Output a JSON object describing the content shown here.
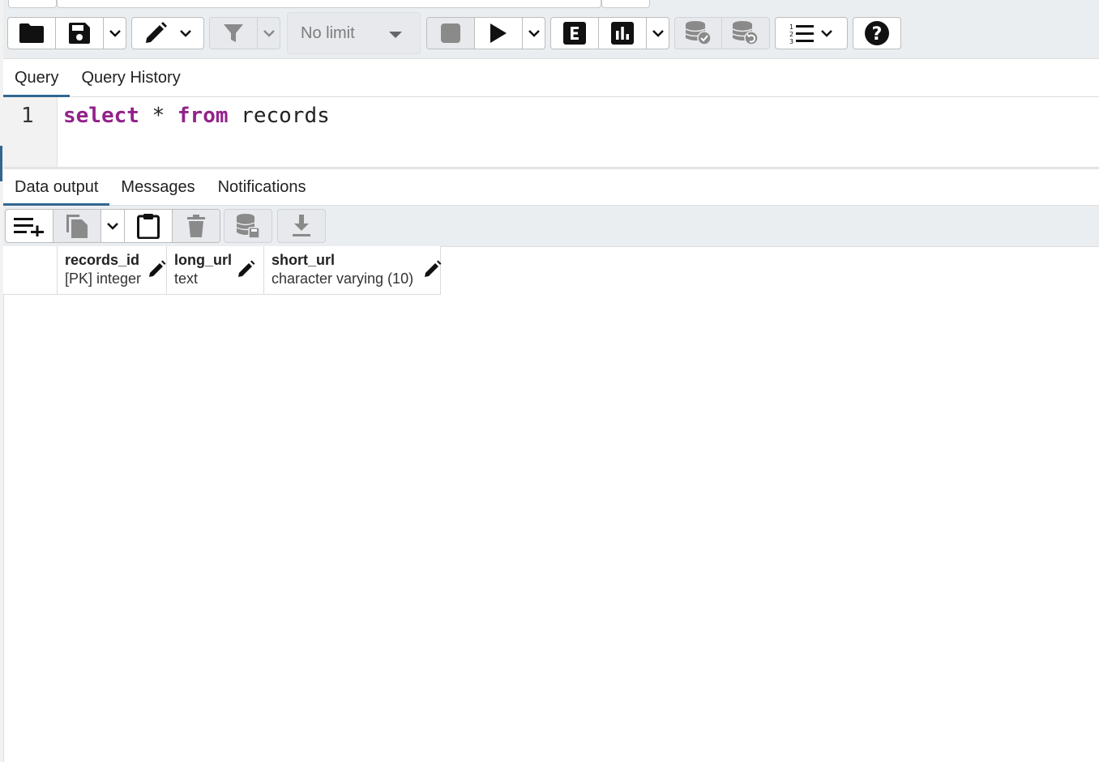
{
  "toolbar": {
    "limit": {
      "label": "No limit"
    },
    "icons": {
      "open_file": "folder-icon",
      "save": "floppy-icon",
      "edit": "pencil-icon",
      "filter": "filter-icon",
      "stop": "stop-icon",
      "execute": "play-icon",
      "explain": "explain-e-icon",
      "explain_analyze": "bar-chart-icon",
      "commit": "database-check-icon",
      "rollback": "database-undo-icon",
      "macros": "numbered-list-icon",
      "help": "question-circle-icon"
    }
  },
  "editor_tabs": [
    {
      "label": "Query",
      "active": true
    },
    {
      "label": "Query History",
      "active": false
    }
  ],
  "editor": {
    "line_number": "1",
    "tokens": {
      "kw1": "select",
      "op": "*",
      "kw2": "from",
      "ident": "records"
    }
  },
  "output_tabs": [
    {
      "label": "Data output",
      "active": true
    },
    {
      "label": "Messages",
      "active": false
    },
    {
      "label": "Notifications",
      "active": false
    }
  ],
  "grid_toolbar": {
    "icons": {
      "add_row": "add-row-icon",
      "copy": "copy-icon",
      "paste": "clipboard-icon",
      "delete": "trash-icon",
      "save_data": "database-save-icon",
      "download": "download-icon"
    }
  },
  "columns": [
    {
      "name": "records_id",
      "type": "[PK] integer"
    },
    {
      "name": "long_url",
      "type": "text"
    },
    {
      "name": "short_url",
      "type": "character varying (10)"
    }
  ],
  "colors": {
    "accent": "#326690",
    "keyword": "#92228a",
    "toolbar_bg": "#ebeef1"
  }
}
